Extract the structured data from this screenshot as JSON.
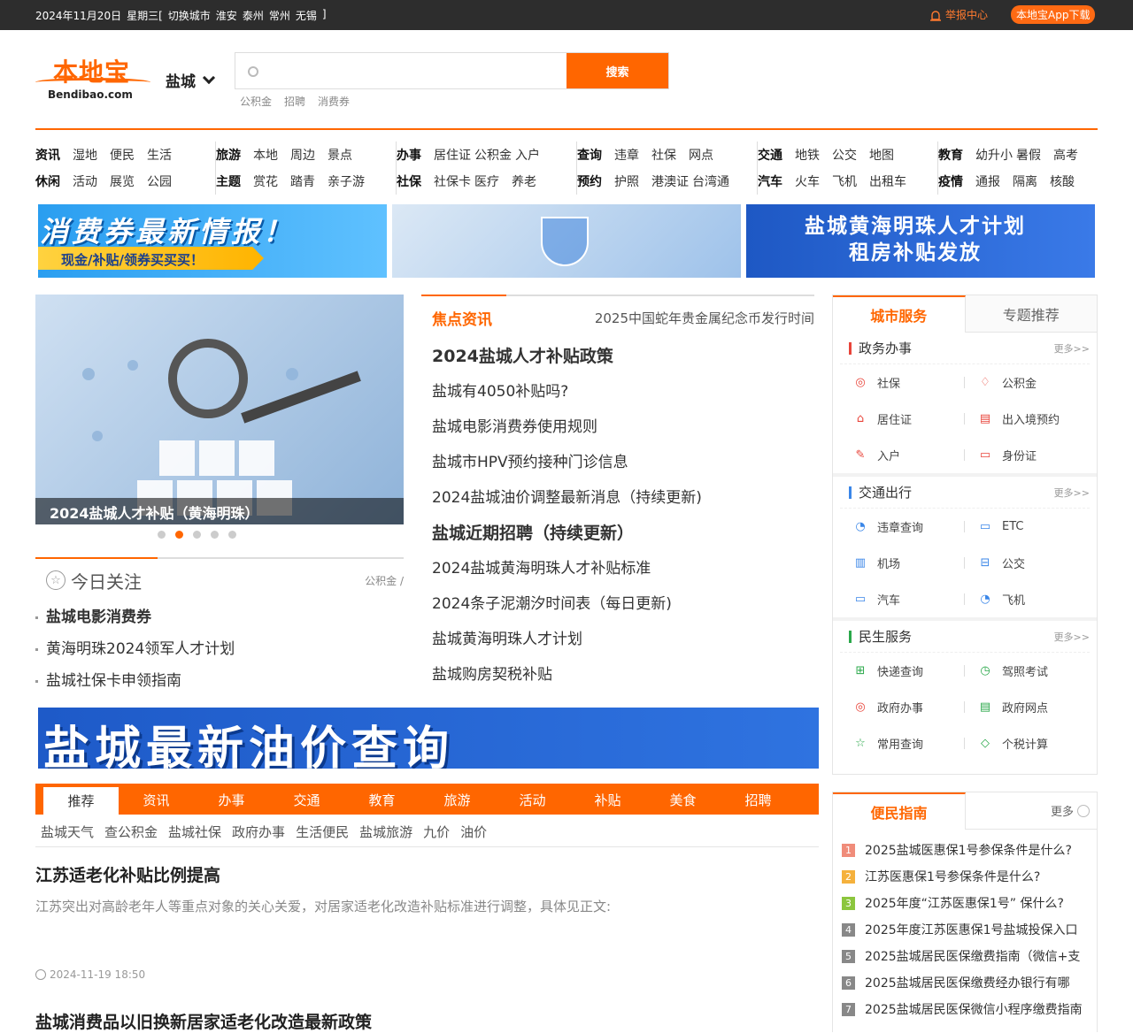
{
  "topbar": {
    "date": "2024年11月20日",
    "weekday": "星期三[",
    "switch_label": "切换城市",
    "cities": [
      "淮安",
      "泰州",
      "常州",
      "无锡"
    ],
    "bracket": "]",
    "report": "举报中心",
    "app_download": "本地宝App下载"
  },
  "logo": {
    "cn": "本地宝",
    "en": "Bendibao.com"
  },
  "city_select": {
    "value": "盐城"
  },
  "search": {
    "placeholder": "",
    "button": "搜索",
    "hot": [
      "公积金",
      "招聘",
      "消费券"
    ]
  },
  "nav": [
    {
      "row1": [
        "资讯",
        "湿地",
        "便民",
        "生活"
      ],
      "row2": [
        "休闲",
        "活动",
        "展览",
        "公园"
      ]
    },
    {
      "row1": [
        "旅游",
        "本地",
        "周边",
        "景点"
      ],
      "row2": [
        "主题",
        "赏花",
        "踏青",
        "亲子游"
      ]
    },
    {
      "row1": [
        "办事",
        "居住证",
        "公积金",
        "入户"
      ],
      "row2": [
        "社保",
        "社保卡",
        "医疗",
        "养老"
      ]
    },
    {
      "row1": [
        "查询",
        "违章",
        "社保",
        "网点"
      ],
      "row2": [
        "预约",
        "护照",
        "港澳证",
        "台湾通"
      ]
    },
    {
      "row1": [
        "交通",
        "地铁",
        "公交",
        "地图"
      ],
      "row2": [
        "汽车",
        "火车",
        "飞机",
        "出租车"
      ]
    },
    {
      "row1": [
        "教育",
        "幼升小",
        "暑假",
        "高考"
      ],
      "row2": [
        "疫情",
        "通报",
        "隔离",
        "核酸"
      ]
    }
  ],
  "banners": {
    "b1_title": "消费券最新情报！",
    "b1_sub": "现金/补贴/领券买买买！",
    "b3_title": "盐城黄海明珠人才计划 租房补贴发放"
  },
  "slider": {
    "caption": "2024盐城人才补贴（黄海明珠）",
    "dots": 5,
    "active": 2
  },
  "today": {
    "title": "今日关注",
    "tag": "公积金 /",
    "items": [
      "盐城电影消费券",
      "黄海明珠2024领军人才计划",
      "盐城社保卡申领指南"
    ]
  },
  "focus": {
    "title": "焦点资讯",
    "marquee": "2025中国蛇年贵金属纪念币发行时间",
    "items": [
      {
        "text": "2024盐城人才补贴政策",
        "headline": true
      },
      {
        "text": "盐城有4050补贴吗?",
        "headline": false
      },
      {
        "text": "盐城电影消费券使用规则",
        "headline": false
      },
      {
        "text": "盐城市HPV预约接种门诊信息",
        "headline": false
      },
      {
        "text": "2024盐城油价调整最新消息（持续更新)",
        "headline": false
      },
      {
        "text": "盐城近期招聘（持续更新）",
        "headline": true
      },
      {
        "text": "2024盐城黄海明珠人才补贴标准",
        "headline": false
      },
      {
        "text": "2024条子泥潮汐时间表（每日更新)",
        "headline": false
      },
      {
        "text": "盐城黄海明珠人才计划",
        "headline": false
      },
      {
        "text": "盐城购房契税补贴",
        "headline": false
      }
    ]
  },
  "big_banner": {
    "title": "盐城最新油价查询"
  },
  "tabs": [
    "推荐",
    "资讯",
    "办事",
    "交通",
    "教育",
    "旅游",
    "活动",
    "补贴",
    "美食",
    "招聘"
  ],
  "sublinks": [
    "盐城天气",
    "查公积金",
    "盐城社保",
    "政府办事",
    "生活便民",
    "盐城旅游",
    "九价",
    "油价"
  ],
  "articles": [
    {
      "title": "江苏适老化补贴比例提高",
      "desc": "江苏突出对高龄老年人等重点对象的关心关爱，对居家适老化改造补贴标准进行调整，具体见正文:",
      "time": "2024-11-19 18:50"
    },
    {
      "title": "盐城消费品以旧换新居家适老化改造最新政策",
      "desc": "",
      "time": ""
    }
  ],
  "services": {
    "tab_active": "城市服务",
    "tab_other": "专题推荐",
    "more": "更多>>",
    "sections": [
      {
        "title": "政务办事",
        "color": "#e8443a",
        "items": [
          {
            "label": "社保",
            "icon": "social-security-icon",
            "glyph": "◎",
            "color": "#e8443a"
          },
          {
            "label": "公积金",
            "icon": "housing-fund-icon",
            "glyph": "♢",
            "color": "#e8443a"
          },
          {
            "label": "居住证",
            "icon": "home-icon",
            "glyph": "⌂",
            "color": "#e8443a"
          },
          {
            "label": "出入境预约",
            "icon": "passport-icon",
            "glyph": "▤",
            "color": "#e8443a"
          },
          {
            "label": "入户",
            "icon": "document-icon",
            "glyph": "✎",
            "color": "#e8443a"
          },
          {
            "label": "身份证",
            "icon": "id-card-icon",
            "glyph": "▭",
            "color": "#e8443a"
          }
        ]
      },
      {
        "title": "交通出行",
        "color": "#3a86e8",
        "items": [
          {
            "label": "违章查询",
            "icon": "violation-icon",
            "glyph": "◔",
            "color": "#3a86e8"
          },
          {
            "label": "ETC",
            "icon": "etc-card-icon",
            "glyph": "▭",
            "color": "#3a86e8"
          },
          {
            "label": "机场",
            "icon": "airport-icon",
            "glyph": "▥",
            "color": "#3a86e8"
          },
          {
            "label": "公交",
            "icon": "bus-icon",
            "glyph": "⊟",
            "color": "#3a86e8"
          },
          {
            "label": "汽车",
            "icon": "car-icon",
            "glyph": "▭",
            "color": "#3a86e8"
          },
          {
            "label": "飞机",
            "icon": "plane-icon",
            "glyph": "◔",
            "color": "#3a86e8"
          }
        ]
      },
      {
        "title": "民生服务",
        "color": "#2aa84a",
        "items": [
          {
            "label": "快递查询",
            "icon": "parcel-icon",
            "glyph": "⊞",
            "color": "#2aa84a"
          },
          {
            "label": "驾照考试",
            "icon": "clock-icon",
            "glyph": "◷",
            "color": "#2aa84a"
          },
          {
            "label": "政府办事",
            "icon": "government-icon",
            "glyph": "◎",
            "color": "#e8443a"
          },
          {
            "label": "政府网点",
            "icon": "outlet-icon",
            "glyph": "▤",
            "color": "#2aa84a"
          },
          {
            "label": "常用查询",
            "icon": "star-icon",
            "glyph": "☆",
            "color": "#2aa84a"
          },
          {
            "label": "个税计算",
            "icon": "tag-icon",
            "glyph": "◇",
            "color": "#2aa84a"
          }
        ]
      }
    ]
  },
  "guide": {
    "title": "便民指南",
    "more": "更多",
    "items": [
      {
        "n": "1",
        "color": "#f08c7a",
        "text": "2025盐城医惠保1号参保条件是什么?"
      },
      {
        "n": "2",
        "color": "#f5b13c",
        "text": "江苏医惠保1号参保条件是什么?"
      },
      {
        "n": "3",
        "color": "#8cc63e",
        "text": "2025年度“江苏医惠保1号” 保什么?"
      },
      {
        "n": "4",
        "color": "#888888",
        "text": "2025年度江苏医惠保1号盐城投保入口"
      },
      {
        "n": "5",
        "color": "#888888",
        "text": "2025盐城居民医保缴费指南（微信+支"
      },
      {
        "n": "6",
        "color": "#888888",
        "text": "2025盐城居民医保缴费经办银行有哪"
      },
      {
        "n": "7",
        "color": "#888888",
        "text": "2025盐城居民医保微信小程序缴费指南"
      }
    ]
  }
}
